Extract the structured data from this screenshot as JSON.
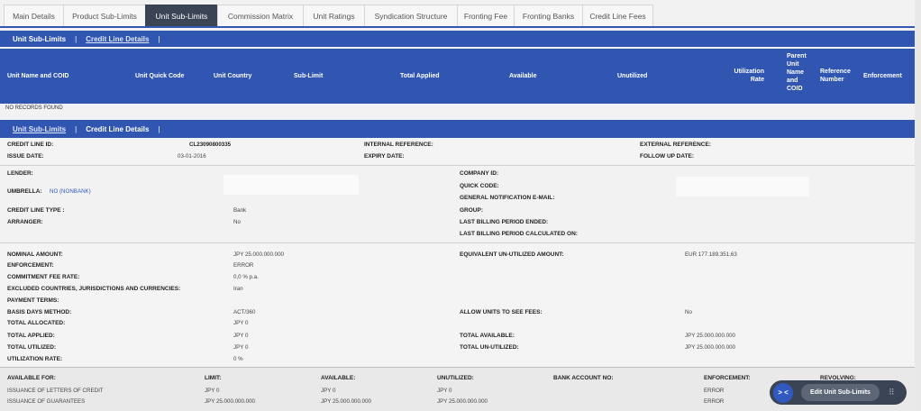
{
  "tabs": [
    {
      "label": "Main Details"
    },
    {
      "label": "Product Sub-Limits"
    },
    {
      "label": "Unit Sub-Limits"
    },
    {
      "label": "Commission Matrix"
    },
    {
      "label": "Unit Ratings"
    },
    {
      "label": "Syndication Structure"
    },
    {
      "label": "Fronting Fee"
    },
    {
      "label": "Fronting Banks"
    },
    {
      "label": "Credit Line Fees"
    }
  ],
  "subnav_top": {
    "item1": "Unit Sub-Limits",
    "sep1": "|",
    "item2": "Credit Line Details",
    "sep2": "|"
  },
  "table": {
    "columns": [
      "Unit Name and COID",
      "Unit Quick Code",
      "Unit Country",
      "Sub-Limit",
      "Total Applied",
      "Available",
      "Unutilized",
      "Utilization Rate",
      "Parent Unit Name and COID",
      "Reference Number",
      "Enforcement"
    ],
    "empty_text": "NO RECORDS FOUND"
  },
  "subnav_bottom": {
    "item1": "Unit Sub-Limits",
    "sep1": "|",
    "item2": "Credit Line Details",
    "sep2": "|"
  },
  "header_info": {
    "credit_line_id_label": "CREDIT LINE ID:",
    "credit_line_id": "CL23090800335",
    "issue_date_label": "ISSUE DATE:",
    "issue_date": "03-01-2016",
    "internal_ref_label": "INTERNAL REFERENCE:",
    "expiry_date_label": "EXPIRY DATE:",
    "external_ref_label": "EXTERNAL REFERENCE:",
    "follow_up_label": "FOLLOW UP DATE:"
  },
  "party": {
    "lender_label": "LENDER:",
    "umbrella_label": "UMBRELLA:",
    "umbrella_value": "NO (NONBANK)",
    "type_label": "CREDIT LINE TYPE :",
    "type_value": "Bank",
    "arranger_label": "ARRANGER:",
    "arranger_value": "No",
    "company_id_label": "COMPANY ID:",
    "quick_code_label": "QUICK CODE:",
    "notif_email_label": "GENERAL NOTIFICATION E-MAIL:",
    "group_label": "GROUP:",
    "last_billing_ended_label": "LAST BILLING PERIOD ENDED:",
    "last_billing_calc_label": "LAST BILLING PERIOD CALCULATED ON:"
  },
  "amounts": {
    "nominal_label": "NOMINAL AMOUNT:",
    "nominal_value": "JPY 25.000.000.000",
    "enforcement_label": "ENFORCEMENT:",
    "enforcement_value": "ERROR",
    "commitment_label": "COMMITMENT FEE RATE:",
    "commitment_value": "0,0 % p.a.",
    "excluded_label": "EXCLUDED COUNTRIES, JURISDICTIONS AND CURRENCIES:",
    "excluded_value": "Iran",
    "payment_terms_label": "PAYMENT TERMS:",
    "basis_label": "BASIS DAYS METHOD:",
    "basis_value": "ACT/360",
    "allocated_label": "TOTAL ALLOCATED:",
    "allocated_value": "JPY 0",
    "applied_label": "TOTAL APPLIED:",
    "applied_value": "JPY 0",
    "utilized_label": "TOTAL UTILIZED:",
    "utilized_value": "JPY 0",
    "rate_label": "UTILIZATION RATE:",
    "rate_value": "0 %",
    "equiv_label": "EQUIVALENT UN-UTILIZED AMOUNT:",
    "equiv_value": "EUR 177.189.351,63",
    "allow_fees_label": "ALLOW UNITS TO SEE FEES:",
    "allow_fees_value": "No",
    "total_available_label": "TOTAL AVAILABLE:",
    "total_available_value": "JPY 25.000.000.000",
    "total_unutilized_label": "TOTAL UN-UTILIZED:",
    "total_unutilized_value": "JPY 25.000.000.000"
  },
  "availability": {
    "headers": [
      "AVAILABLE FOR:",
      "LIMIT:",
      "AVAILABLE:",
      "UNUTILIZED:",
      "BANK ACCOUNT NO:",
      "ENFORCEMENT:",
      "REVOLVING:"
    ],
    "rows": [
      {
        "for": "ISSUANCE OF LETTERS OF CREDIT",
        "limit": "JPY 0",
        "available": "JPY 0",
        "unutilized": "JPY 0",
        "enforcement": "ERROR"
      },
      {
        "for": "ISSUANCE OF GUARANTEES",
        "limit": "JPY 25.000.000.000",
        "available": "JPY 25.000.000.000",
        "unutilized": "JPY 25.000.000.000",
        "enforcement": "ERROR"
      }
    ]
  },
  "fab": {
    "toggle": "> <",
    "edit_label": "Edit Unit Sub-Limits",
    "grid": "⠿"
  }
}
